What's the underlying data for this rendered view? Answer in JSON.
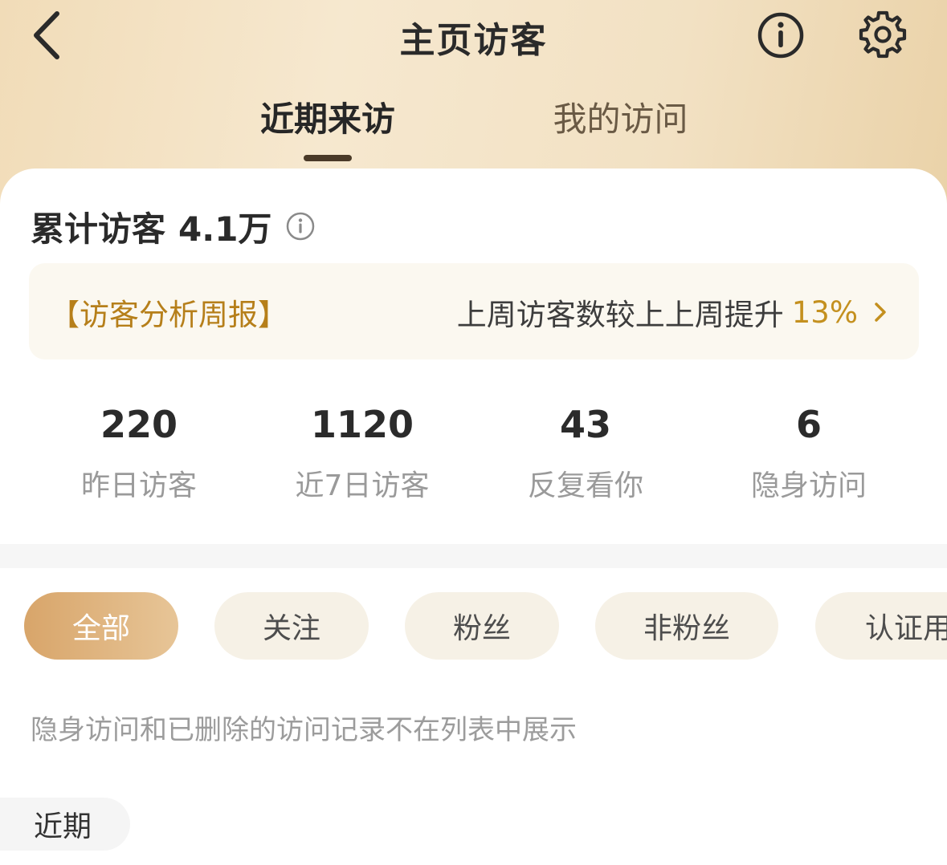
{
  "nav": {
    "title": "主页访客"
  },
  "tabs": [
    {
      "label": "近期来访",
      "active": true
    },
    {
      "label": "我的访问",
      "active": false
    }
  ],
  "summary": {
    "total_label": "累计访客",
    "total_value": "4.1万"
  },
  "report": {
    "label": "【访客分析周报】",
    "text": "上周访客数较上上周提升",
    "percent": "13%"
  },
  "stats": [
    {
      "value": "220",
      "label": "昨日访客"
    },
    {
      "value": "1120",
      "label": "近7日访客"
    },
    {
      "value": "43",
      "label": "反复看你"
    },
    {
      "value": "6",
      "label": "隐身访问"
    }
  ],
  "filters": [
    {
      "label": "全部",
      "active": true
    },
    {
      "label": "关注",
      "active": false
    },
    {
      "label": "粉丝",
      "active": false
    },
    {
      "label": "非粉丝",
      "active": false
    },
    {
      "label": "认证用",
      "active": false
    }
  ],
  "notice": "隐身访问和已删除的访问记录不在列表中展示",
  "section_tag": "近期",
  "colors": {
    "accent": "#c4901f",
    "active_chip_start": "#d8a56a",
    "active_chip_end": "#e7c597",
    "header_bg": "#f1dcb8"
  },
  "icons": {
    "back": "chevron-left-icon",
    "info": "info-icon",
    "settings": "gear-icon",
    "report_arrow": "chevron-right-icon"
  }
}
